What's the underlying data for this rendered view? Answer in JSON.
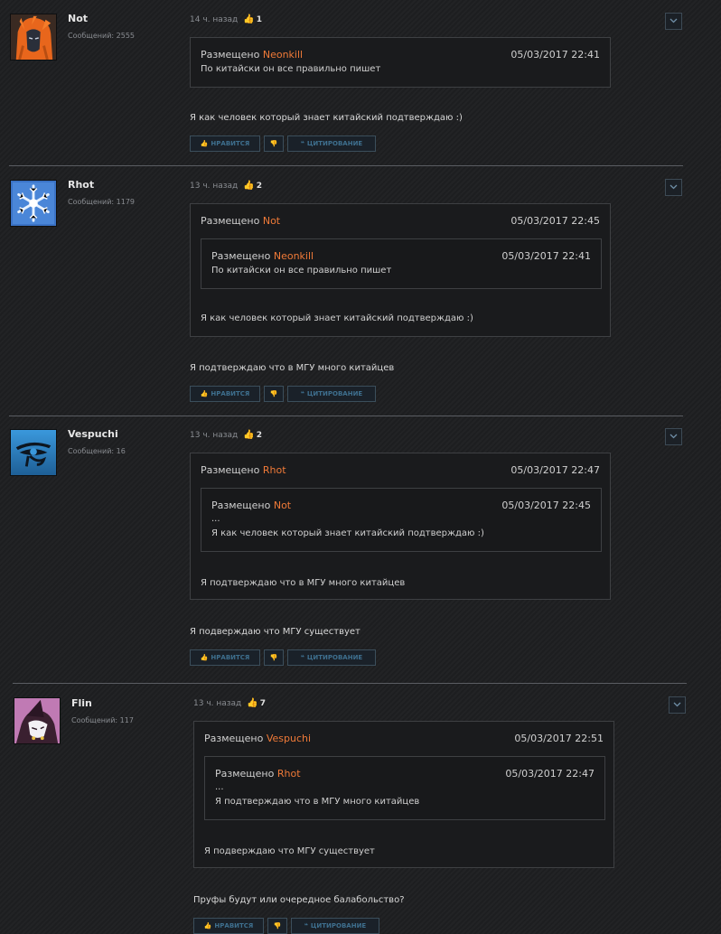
{
  "buttons": {
    "like": "НРАВИТСЯ",
    "dislike_icon": "thumbs-down-icon",
    "quote": "ЦИТИРОВАНИЕ"
  },
  "colors": {
    "author": "#f07a38",
    "likes": "#f0a030",
    "button_text": "#3e6f8e"
  },
  "posts": [
    {
      "user": {
        "name": "Not",
        "posts": "Сообщений: 2555",
        "avatar": "orange-hair-character-avatar"
      },
      "time": "14 ч. назад",
      "likes": "1",
      "quote": {
        "prefix": "Размещено",
        "author": "Neonkill",
        "date": "05/03/2017 22:41",
        "lines": [
          "По китайски он все правильно пишет"
        ]
      },
      "text": "Я как человек который знает китайский подтверждаю :)"
    },
    {
      "user": {
        "name": "Rhot",
        "posts": "Сообщений: 1179",
        "avatar": "snowflake-avatar"
      },
      "time": "13 ч. назад",
      "likes": "2",
      "quote": {
        "prefix": "Размещено",
        "author": "Not",
        "date": "05/03/2017 22:45",
        "inner": {
          "prefix": "Размещено",
          "author": "Neonkill",
          "date": "05/03/2017 22:41",
          "lines": [
            "По китайски он все правильно пишет"
          ]
        },
        "lines": [
          "Я как человек который знает китайский подтверждаю :)"
        ]
      },
      "text": "Я подтверждаю что в МГУ много китайцев"
    },
    {
      "user": {
        "name": "Vespuchi",
        "posts": "Сообщений: 16",
        "avatar": "eye-of-horus-avatar"
      },
      "time": "13 ч. назад",
      "likes": "2",
      "quote": {
        "prefix": "Размещено",
        "author": "Rhot",
        "date": "05/03/2017 22:47",
        "inner": {
          "prefix": "Размещено",
          "author": "Not",
          "date": "05/03/2017 22:45",
          "lines": [
            "...",
            "Я как человек который знает китайский подтверждаю :)"
          ]
        },
        "lines": [
          "Я подтверждаю что в МГУ много китайцев"
        ]
      },
      "text": "Я подверждаю что МГУ существует"
    },
    {
      "user": {
        "name": "Flin",
        "posts": "Сообщений: 117",
        "avatar": "witch-character-avatar"
      },
      "time": "13 ч. назад",
      "likes": "7",
      "quote": {
        "prefix": "Размещено",
        "author": "Vespuchi",
        "date": "05/03/2017 22:51",
        "inner": {
          "prefix": "Размещено",
          "author": "Rhot",
          "date": "05/03/2017 22:47",
          "lines": [
            "...",
            "Я подтверждаю что в МГУ много китайцев"
          ]
        },
        "lines": [
          "Я подверждаю что МГУ существует"
        ]
      },
      "text": "Пруфы будут или очередное балабольство?"
    }
  ]
}
